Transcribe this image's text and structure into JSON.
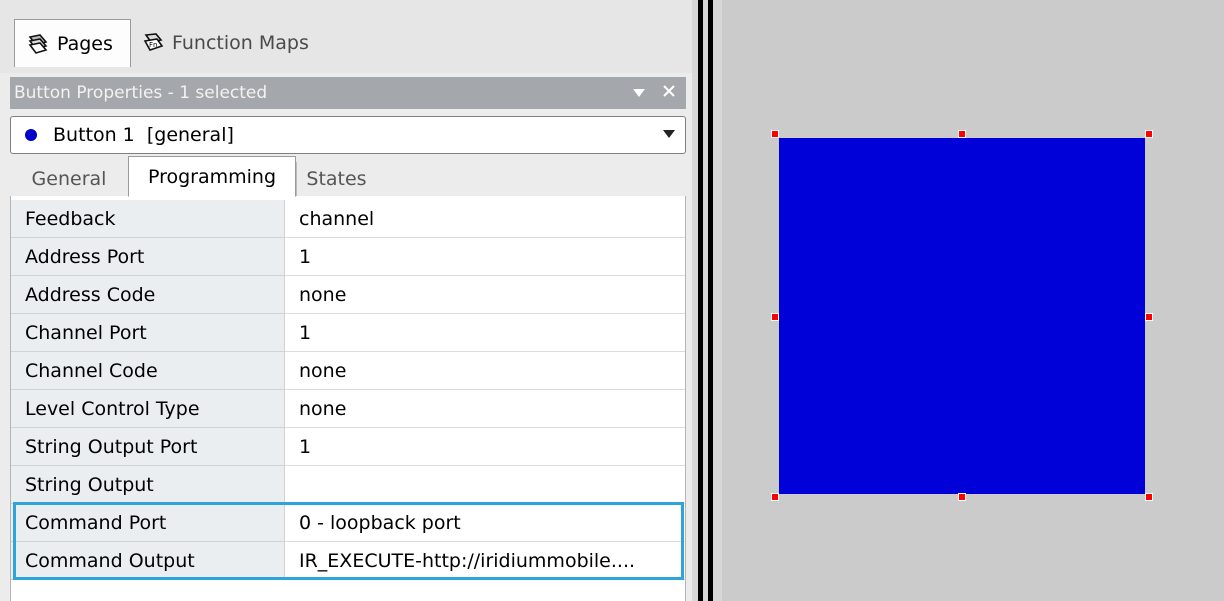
{
  "top_tabs": [
    {
      "label": "Pages",
      "icon": "pages-icon"
    },
    {
      "label": "Function Maps",
      "icon": "function-maps-icon"
    }
  ],
  "panel": {
    "title": "Button Properties - 1 selected",
    "dropdown_icon": "chevron-down-icon",
    "close_icon": "close-icon"
  },
  "selector": {
    "value": "Button 1  [general]",
    "color": "#0000c8"
  },
  "property_tabs": [
    "General",
    "Programming",
    "States"
  ],
  "active_property_tab": "Programming",
  "properties": [
    {
      "name": "Feedback",
      "value": "channel"
    },
    {
      "name": "Address Port",
      "value": "1"
    },
    {
      "name": "Address Code",
      "value": "none"
    },
    {
      "name": "Channel Port",
      "value": "1"
    },
    {
      "name": "Channel Code",
      "value": "none"
    },
    {
      "name": "Level Control Type",
      "value": "none"
    },
    {
      "name": "String Output Port",
      "value": "1"
    },
    {
      "name": "String Output",
      "value": ""
    },
    {
      "name": "Command Port",
      "value": "0 - loopback port"
    },
    {
      "name": "Command Output",
      "value": "IR_EXECUTE-http://iridiummobile...."
    }
  ],
  "highlight_color": "#2ea3dc",
  "canvas": {
    "button_color": "#0000d8",
    "handle_color": "#ff0000"
  }
}
